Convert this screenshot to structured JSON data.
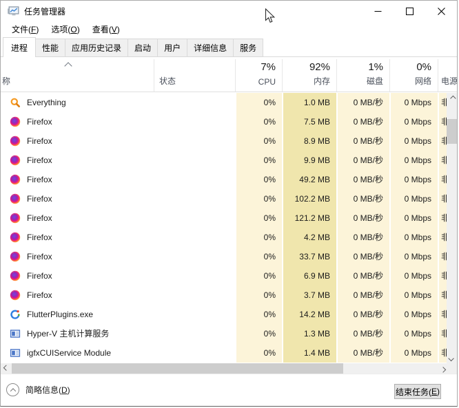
{
  "window": {
    "title": "任务管理器"
  },
  "menu_bar": {
    "items": [
      {
        "pre": "文件(",
        "key": "F",
        "post": ")"
      },
      {
        "pre": "选项(",
        "key": "O",
        "post": ")"
      },
      {
        "pre": "查看(",
        "key": "V",
        "post": ")"
      }
    ]
  },
  "tabs": [
    {
      "label": "进程",
      "active": true
    },
    {
      "label": "性能",
      "active": false
    },
    {
      "label": "应用历史记录",
      "active": false
    },
    {
      "label": "启动",
      "active": false
    },
    {
      "label": "用户",
      "active": false
    },
    {
      "label": "详细信息",
      "active": false
    },
    {
      "label": "服务",
      "active": false
    }
  ],
  "table": {
    "headers": {
      "name": "称",
      "status": "状态",
      "cpu": {
        "percent": "7%",
        "label": "CPU"
      },
      "memory": {
        "percent": "92%",
        "label": "内存"
      },
      "disk": {
        "percent": "1%",
        "label": "磁盘"
      },
      "network": {
        "percent": "0%",
        "label": "网络"
      },
      "power": {
        "label": "电源"
      }
    }
  },
  "processes": [
    {
      "name": "Everything",
      "icon": "everything-search-icon",
      "status": "",
      "cpu": "0%",
      "memory": "1.0 MB",
      "disk": "0 MB/秒",
      "network": "0 Mbps",
      "power": "非"
    },
    {
      "name": "Firefox",
      "icon": "firefox-icon",
      "status": "",
      "cpu": "0%",
      "memory": "7.5 MB",
      "disk": "0 MB/秒",
      "network": "0 Mbps",
      "power": "非"
    },
    {
      "name": "Firefox",
      "icon": "firefox-icon",
      "status": "",
      "cpu": "0%",
      "memory": "8.9 MB",
      "disk": "0 MB/秒",
      "network": "0 Mbps",
      "power": "非"
    },
    {
      "name": "Firefox",
      "icon": "firefox-icon",
      "status": "",
      "cpu": "0%",
      "memory": "9.9 MB",
      "disk": "0 MB/秒",
      "network": "0 Mbps",
      "power": "非"
    },
    {
      "name": "Firefox",
      "icon": "firefox-icon",
      "status": "",
      "cpu": "0%",
      "memory": "49.2 MB",
      "disk": "0 MB/秒",
      "network": "0 Mbps",
      "power": "非"
    },
    {
      "name": "Firefox",
      "icon": "firefox-icon",
      "status": "",
      "cpu": "0%",
      "memory": "102.2 MB",
      "disk": "0 MB/秒",
      "network": "0 Mbps",
      "power": "非"
    },
    {
      "name": "Firefox",
      "icon": "firefox-icon",
      "status": "",
      "cpu": "0%",
      "memory": "121.2 MB",
      "disk": "0 MB/秒",
      "network": "0 Mbps",
      "power": "非"
    },
    {
      "name": "Firefox",
      "icon": "firefox-icon",
      "status": "",
      "cpu": "0%",
      "memory": "4.2 MB",
      "disk": "0 MB/秒",
      "network": "0 Mbps",
      "power": "非"
    },
    {
      "name": "Firefox",
      "icon": "firefox-icon",
      "status": "",
      "cpu": "0%",
      "memory": "33.7 MB",
      "disk": "0 MB/秒",
      "network": "0 Mbps",
      "power": "非"
    },
    {
      "name": "Firefox",
      "icon": "firefox-icon",
      "status": "",
      "cpu": "0%",
      "memory": "6.9 MB",
      "disk": "0 MB/秒",
      "network": "0 Mbps",
      "power": "非"
    },
    {
      "name": "Firefox",
      "icon": "firefox-icon",
      "status": "",
      "cpu": "0%",
      "memory": "3.7 MB",
      "disk": "0 MB/秒",
      "network": "0 Mbps",
      "power": "非"
    },
    {
      "name": "FlutterPlugins.exe",
      "icon": "flutterplugins-icon",
      "status": "",
      "cpu": "0%",
      "memory": "14.2 MB",
      "disk": "0 MB/秒",
      "network": "0 Mbps",
      "power": "非"
    },
    {
      "name": "Hyper-V 主机计算服务",
      "icon": "window-icon",
      "status": "",
      "cpu": "0%",
      "memory": "1.3 MB",
      "disk": "0 MB/秒",
      "network": "0 Mbps",
      "power": "非"
    },
    {
      "name": "igfxCUIService Module",
      "icon": "window-icon",
      "status": "",
      "cpu": "0%",
      "memory": "1.4 MB",
      "disk": "0 MB/秒",
      "network": "0 Mbps",
      "power": "非"
    }
  ],
  "footer": {
    "details_toggle": {
      "pre": "简略信息(",
      "key": "D",
      "post": ")"
    },
    "end_task_button": {
      "pre": "结束任务(",
      "key": "E",
      "post": ")"
    }
  },
  "colors": {
    "heat_low": "#fcf4d9",
    "heat_memory": "#f0e6ad",
    "tab_border": "#d9d9d9",
    "scrollbar_track": "#f0f0f0",
    "scrollbar_thumb": "#cdcdcd"
  }
}
